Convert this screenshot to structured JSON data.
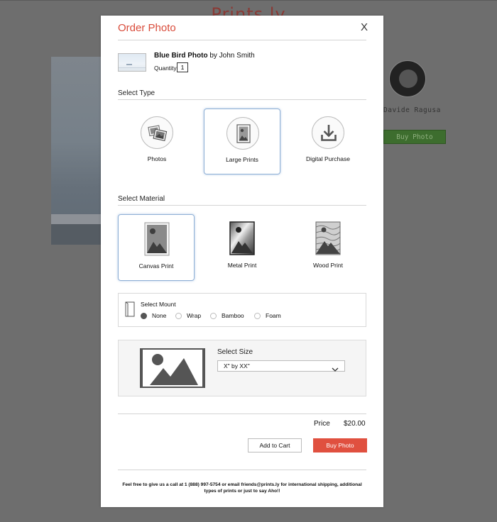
{
  "background": {
    "logo": "Prints.ly",
    "author_name": "Davide Ragusa",
    "buy_label": "Buy Photo"
  },
  "modal": {
    "title": "Order Photo",
    "close_label": "X",
    "photo": {
      "title": "Blue Bird Photo",
      "by_text": "by John Smith",
      "quantity_label": "Quantity",
      "quantity_value": "1"
    },
    "type_section": {
      "label": "Select Type",
      "options": [
        {
          "label": "Photos",
          "icon": "photos-icon",
          "selected": false
        },
        {
          "label": "Large Prints",
          "icon": "large-print-icon",
          "selected": true
        },
        {
          "label": "Digital Purchase",
          "icon": "download-icon",
          "selected": false
        }
      ]
    },
    "material_section": {
      "label": "Select Material",
      "options": [
        {
          "label": "Canvas Print",
          "icon": "canvas-print-icon",
          "selected": true
        },
        {
          "label": "Metal Print",
          "icon": "metal-print-icon",
          "selected": false
        },
        {
          "label": "Wood Print",
          "icon": "wood-print-icon",
          "selected": false
        }
      ]
    },
    "mount": {
      "title": "Select Mount",
      "options": [
        {
          "label": "None",
          "selected": true
        },
        {
          "label": "Wrap",
          "selected": false
        },
        {
          "label": "Bamboo",
          "selected": false
        },
        {
          "label": "Foam",
          "selected": false
        }
      ]
    },
    "size": {
      "title": "Select Size",
      "selected_value": "X\" by XX\""
    },
    "price": {
      "label": "Price",
      "value": "$20.00"
    },
    "buttons": {
      "add_to_cart": "Add to Cart",
      "buy_photo": "Buy Photo"
    },
    "footer_note": "Feel free to give us a call at 1 (888) 997-5754 or email friends@prints.ly for international shipping, additional types of prints or just to say Aho!!"
  },
  "colors": {
    "accent": "#e0503f",
    "title": "#d94b3a",
    "selection_border": "#8fb0d6",
    "overlay": "#6e6e6e"
  }
}
